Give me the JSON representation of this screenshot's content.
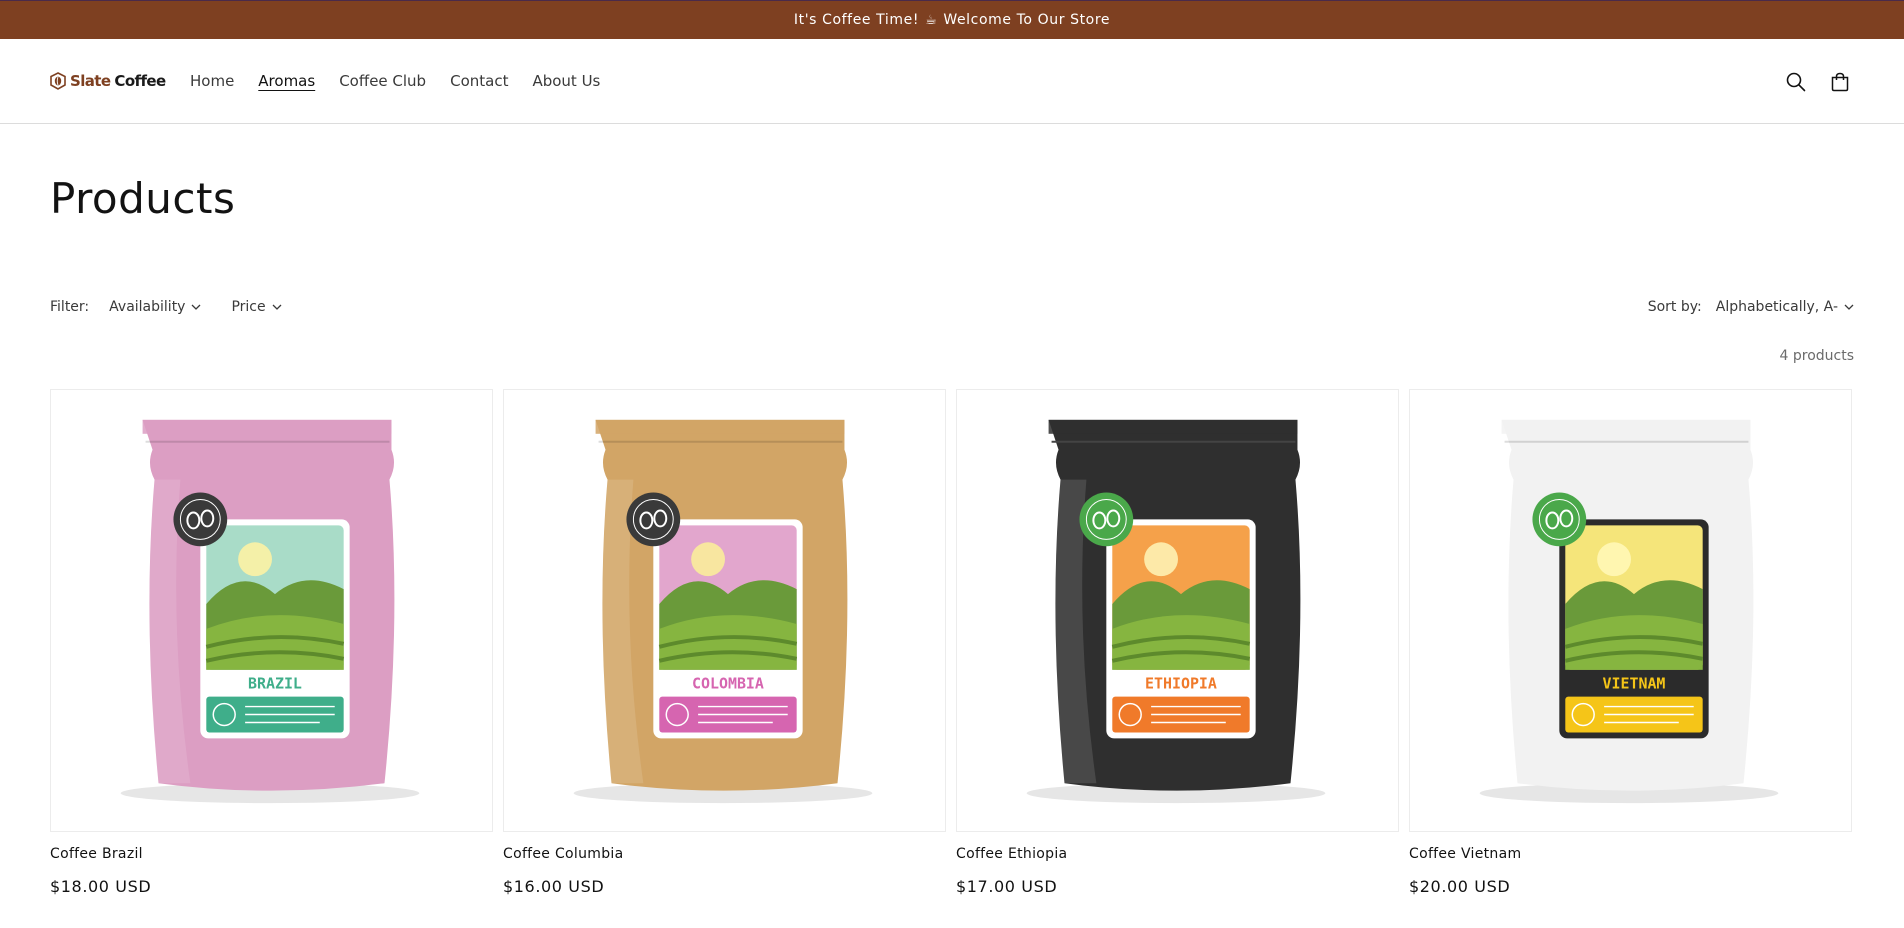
{
  "announcement": {
    "text_before": "It's Coffee Time!",
    "cup_glyph": "☕",
    "text_after": "Welcome To Our Store"
  },
  "header": {
    "logo": {
      "brand": "Slate",
      "brand_word2": "Coffee",
      "icon": "coffee-bean-shield-icon"
    },
    "nav": [
      {
        "label": "Home",
        "active": false
      },
      {
        "label": "Aromas",
        "active": true
      },
      {
        "label": "Coffee Club",
        "active": false
      },
      {
        "label": "Contact",
        "active": false
      },
      {
        "label": "About Us",
        "active": false
      }
    ],
    "icons": [
      "search-icon",
      "cart-icon"
    ]
  },
  "collection": {
    "title": "Products",
    "filter_label": "Filter:",
    "facets": [
      {
        "label": "Availability"
      },
      {
        "label": "Price"
      }
    ],
    "sort_label": "Sort by:",
    "sort_value": "Alphabetically, A-",
    "product_count": "4 products"
  },
  "products": [
    {
      "title": "Coffee Brazil",
      "price": "$18.00 USD",
      "bag_color": "#dc9ec3",
      "label_name": "BRAZIL",
      "accent": "#3fae8a",
      "sky": "#a9dcc8",
      "sun": "#f4f0a8",
      "badge": "#3a3a3a"
    },
    {
      "title": "Coffee Columbia",
      "price": "$16.00 USD",
      "bag_color": "#d2a566",
      "label_name": "COLOMBIA",
      "accent": "#d665b0",
      "sky": "#e2a6cd",
      "sun": "#f8e6a0",
      "badge": "#3a3a3a"
    },
    {
      "title": "Coffee Ethiopia",
      "price": "$17.00 USD",
      "bag_color": "#2f2f2f",
      "label_name": "ETHIOPIA",
      "accent": "#f07a2a",
      "sky": "#f5a14a",
      "sun": "#fde9a8",
      "badge": "#4aa84a"
    },
    {
      "title": "Coffee Vietnam",
      "price": "$20.00 USD",
      "bag_color": "#f2f2f2",
      "label_name": "VIETNAM",
      "accent": "#f5c518",
      "sky": "#f5e57a",
      "sun": "#fff6b0",
      "badge": "#4aa84a"
    }
  ]
}
